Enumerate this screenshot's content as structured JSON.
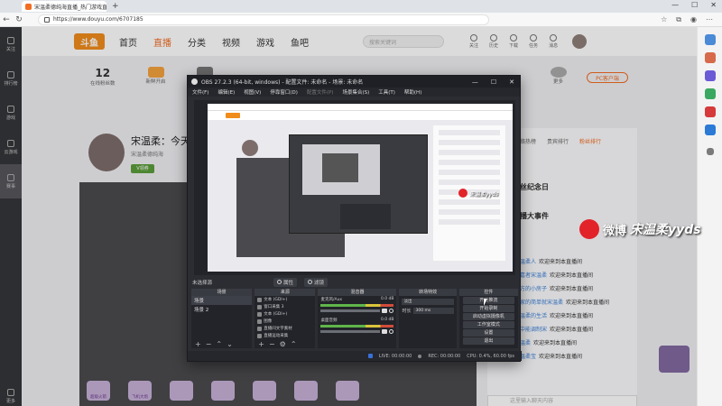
{
  "browser": {
    "tab_title": "宋温柔德纯海直播_热门游戏直播",
    "url": "https://www.douyu.com/6707185"
  },
  "site": {
    "logo": "斗鱼",
    "nav": [
      "首页",
      "直播",
      "分类",
      "视频",
      "游戏",
      "鱼吧"
    ],
    "search_placeholder": "搜索关键词",
    "header_icons": [
      "关注",
      "历史",
      "下载",
      "任务",
      "消息"
    ],
    "stats": [
      {
        "big": "12",
        "label": "在线粉丝数"
      },
      {
        "big": "",
        "label": "新鲜开启"
      },
      {
        "big": "",
        "label": "语音"
      },
      {
        "big": "",
        "label": "更多"
      }
    ],
    "pc_button": "PC客户端",
    "left_nav": [
      "关注",
      "排行榜",
      "游戏",
      "云游戏",
      "赛事",
      "更多"
    ],
    "streamer_name": "宋温柔：今天直",
    "streamer_sub": "宋温柔德纯海",
    "badge": "V领券",
    "right_tabs": [
      "网络热榜",
      "贵宾排行",
      "粉丝排行"
    ],
    "rank_title_1": "粉丝纪念日",
    "rank_title_2": "直播大事件",
    "chat": [
      {
        "user": "宋温柔人",
        "text": "欢迎来到本直播间"
      },
      {
        "user": "浅嘉者宋温柔",
        "text": "欢迎来到本直播间"
      },
      {
        "user": "后方的小房子",
        "text": "欢迎来到本直播间"
      },
      {
        "user": "大家的简单就宋温柔",
        "text": "欢迎来到本直播间"
      },
      {
        "user": "宋温柔的生活",
        "text": "欢迎来到本直播间"
      },
      {
        "user": "为中能调制宋",
        "text": "欢迎来到本直播间"
      },
      {
        "user": "宋温柔",
        "text": "欢迎来到本直播间"
      },
      {
        "user": "宋温柔宝",
        "text": "欢迎来到本直播间"
      }
    ],
    "chat_placeholder": "这里输入聊天内容",
    "gifts": [
      "超级火箭",
      "飞机大炮",
      "",
      "",
      "",
      "",
      ""
    ]
  },
  "watermark": {
    "brand": "微博",
    "name": "宋温柔yyds"
  },
  "obs": {
    "title": "OBS 27.2.3 (64-bit, windows) - 配置文件: 未命名 - 场景: 未命名",
    "menu": [
      "文件(F)",
      "编辑(E)",
      "视图(V)",
      "停靠窗口(D)",
      "配置文件(P)",
      "场景集合(S)",
      "工具(T)",
      "帮助(H)"
    ],
    "scene_label": "未选择源",
    "btn_properties": "属性",
    "btn_filters": "滤镜",
    "docks": {
      "scenes": "场景",
      "sources": "来源",
      "mixer": "混音器",
      "transitions": "转场特效",
      "controls": "控件"
    },
    "scenes": [
      "场景",
      "场景 2"
    ],
    "sources": [
      "文本 (GDI+)",
      "窗口采集 3",
      "文本 (GDI+)",
      "图像",
      "直播间文字素材",
      "直播运动采集"
    ],
    "mixer_channels": [
      {
        "name": "麦克风/Aux",
        "db": "0.0 dB"
      },
      {
        "name": "桌面音频",
        "db": "0.0 dB"
      }
    ],
    "transition_type": "淡出",
    "duration_label": "时长",
    "duration_value": "300 ms",
    "controls": [
      "开始推流",
      "开始录制",
      "启动虚拟摄像机",
      "工作室模式",
      "设置",
      "退出"
    ],
    "status": {
      "live": "LIVE: 00:00:00",
      "rec": "REC: 00:00:00",
      "cpu": "CPU: 0.4%, 60.00 fps"
    }
  },
  "colors": {
    "brand_orange": "#f26d22",
    "obs_bg": "#2b2d33",
    "weibo_red": "#e2232a"
  }
}
